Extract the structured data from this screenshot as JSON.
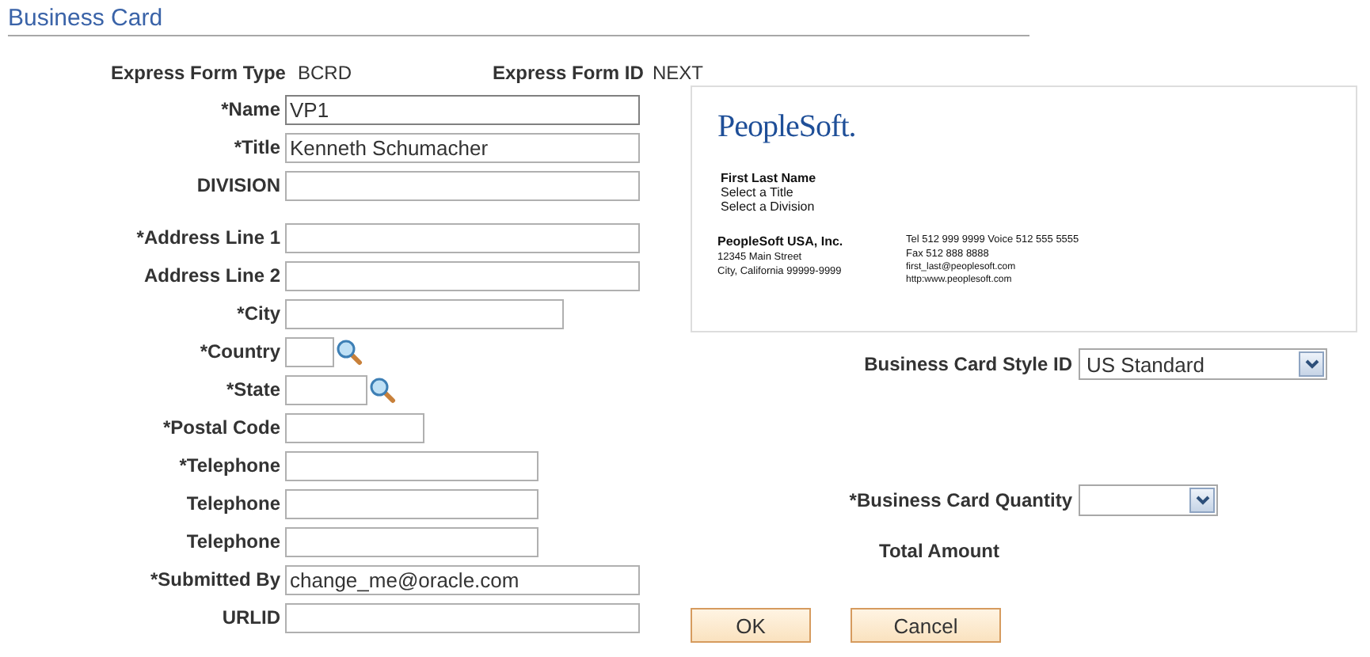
{
  "page_title": "Business Card",
  "express": {
    "type_label": "Express Form Type",
    "type_value": "BCRD",
    "id_label": "Express Form ID",
    "id_value": "NEXT"
  },
  "fields": [
    {
      "label": "*Name",
      "kind": "text",
      "value": "VP1",
      "focused": true
    },
    {
      "label": "*Title",
      "kind": "text",
      "value": "Kenneth Schumacher",
      "focused": false
    },
    {
      "label": "DIVISION",
      "kind": "text",
      "focused": false
    },
    {
      "label": "*Address Line 1",
      "kind": "text",
      "focused": false
    },
    {
      "label": "Address Line 2",
      "kind": "text",
      "focused": false
    },
    {
      "label": "*City",
      "kind": "text",
      "focused": false
    },
    {
      "label": "*Country",
      "kind": "lookup",
      "focused": false
    },
    {
      "label": "*State",
      "kind": "lookup",
      "focused": false
    },
    {
      "label": "*Postal Code",
      "kind": "text",
      "focused": false
    },
    {
      "label": "*Telephone",
      "kind": "text",
      "focused": false
    },
    {
      "label": "Telephone",
      "kind": "text",
      "focused": false
    },
    {
      "label": "Telephone",
      "kind": "text",
      "focused": false
    },
    {
      "label": "*Submitted By",
      "kind": "text",
      "value": "change_me@oracle.com",
      "focused": false
    },
    {
      "label": "URLID",
      "kind": "text",
      "focused": false
    }
  ],
  "card_preview": {
    "logo": "PeopleSoft.",
    "name": "First Last Name",
    "title": "Select a Title",
    "division": "Select a Division",
    "company": "PeopleSoft USA, Inc.",
    "address": [
      "12345 Main Street",
      "City, California 99999-9999"
    ],
    "contact": [
      "Tel 512 999 9999  Voice 512 555 5555",
      "Fax 512 888 8888",
      "first_last@peoplesoft.com",
      "http:www.peoplesoft.com"
    ]
  },
  "style": {
    "label": "Business Card Style ID",
    "value": "US Standard"
  },
  "quantity": {
    "label": "*Business Card Quantity"
  },
  "total_label": "Total Amount",
  "buttons": [
    "OK",
    "Cancel"
  ]
}
